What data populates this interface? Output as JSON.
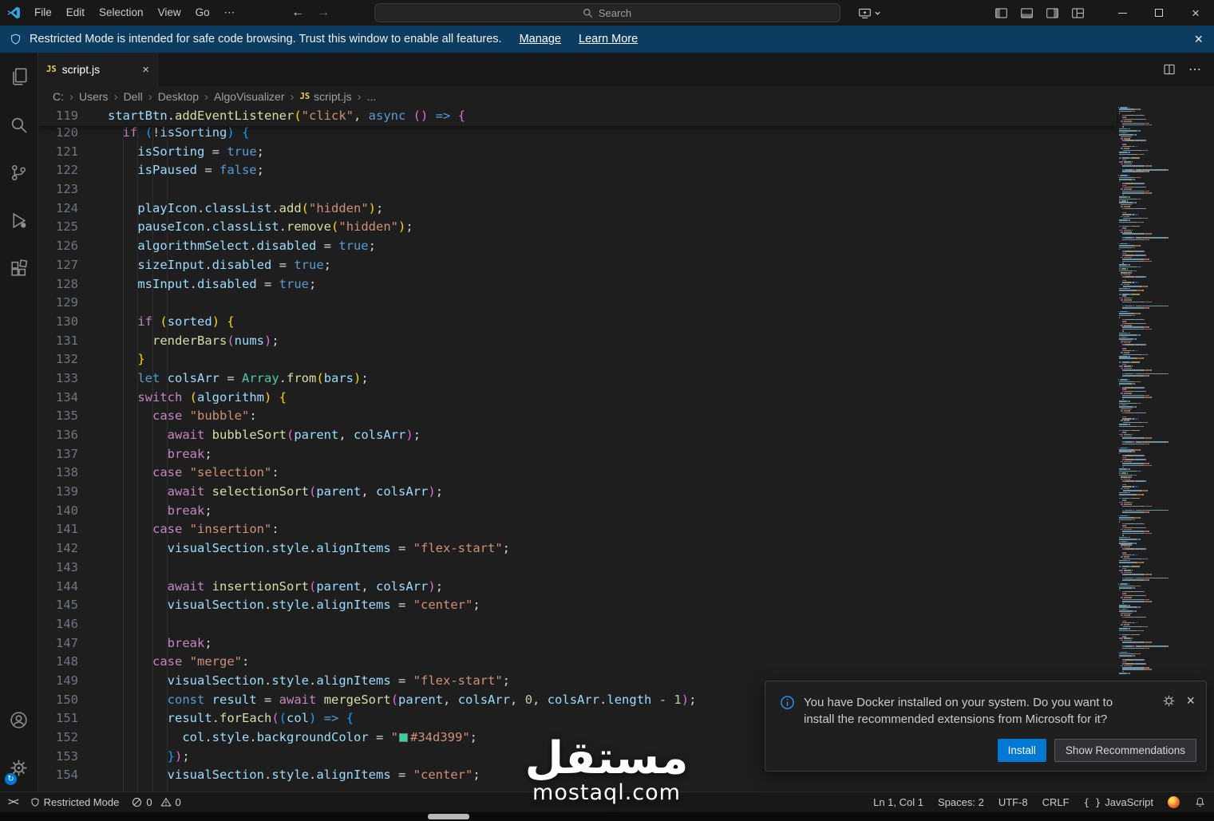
{
  "titlebar": {
    "menus": [
      "File",
      "Edit",
      "Selection",
      "View",
      "Go",
      "⋯"
    ],
    "search_placeholder": "Search"
  },
  "banner": {
    "text": "Restricted Mode is intended for safe code browsing. Trust this window to enable all features.",
    "manage": "Manage",
    "learn_more": "Learn More"
  },
  "tabs": {
    "active_label": "script.js"
  },
  "breadcrumbs": {
    "items": [
      "C:",
      "Users",
      "Dell",
      "Desktop",
      "AlgoVisualizer",
      "script.js",
      "..."
    ]
  },
  "editor": {
    "token_colors": {
      "d": "#d4d4d4",
      "v": "#9cdcfe",
      "f": "#dcdcaa",
      "s": "#ce9178",
      "k": "#c586c0",
      "b": "#569cd6",
      "n": "#b5cea8",
      "c": "#4ec9b0",
      "p1": "#ffd700",
      "p2": "#da70d6",
      "p3": "#179fff"
    },
    "accent_color": "#0078d4",
    "swatch_color": "#34d399",
    "sticky_line": {
      "n": 119,
      "t": [
        [
          "v",
          "startBtn"
        ],
        [
          "d",
          "."
        ],
        [
          "f",
          "addEventListener"
        ],
        [
          "p1",
          "("
        ],
        [
          "s",
          "\"click\""
        ],
        [
          "d",
          ", "
        ],
        [
          "b",
          "async"
        ],
        [
          "d",
          " "
        ],
        [
          "p2",
          "()"
        ],
        [
          "d",
          " "
        ],
        [
          "b",
          "=>"
        ],
        [
          "d",
          " "
        ],
        [
          "p2",
          "{"
        ]
      ]
    },
    "lines": [
      {
        "n": 120,
        "t": [
          [
            "d",
            "  "
          ],
          [
            "k",
            "if"
          ],
          [
            "d",
            " "
          ],
          [
            "p3",
            "("
          ],
          [
            "d",
            "!"
          ],
          [
            "v",
            "isSorting"
          ],
          [
            "p3",
            ")"
          ],
          [
            "d",
            " "
          ],
          [
            "p3",
            "{"
          ]
        ]
      },
      {
        "n": 121,
        "t": [
          [
            "d",
            "    "
          ],
          [
            "v",
            "isSorting"
          ],
          [
            "d",
            " = "
          ],
          [
            "b",
            "true"
          ],
          [
            "d",
            ";"
          ]
        ]
      },
      {
        "n": 122,
        "t": [
          [
            "d",
            "    "
          ],
          [
            "v",
            "isPaused"
          ],
          [
            "d",
            " = "
          ],
          [
            "b",
            "false"
          ],
          [
            "d",
            ";"
          ]
        ]
      },
      {
        "n": 123,
        "t": []
      },
      {
        "n": 124,
        "t": [
          [
            "d",
            "    "
          ],
          [
            "v",
            "playIcon"
          ],
          [
            "d",
            "."
          ],
          [
            "v",
            "classList"
          ],
          [
            "d",
            "."
          ],
          [
            "f",
            "add"
          ],
          [
            "p1",
            "("
          ],
          [
            "s",
            "\"hidden\""
          ],
          [
            "p1",
            ")"
          ],
          [
            "d",
            ";"
          ]
        ]
      },
      {
        "n": 125,
        "t": [
          [
            "d",
            "    "
          ],
          [
            "v",
            "pauseIcon"
          ],
          [
            "d",
            "."
          ],
          [
            "v",
            "classList"
          ],
          [
            "d",
            "."
          ],
          [
            "f",
            "remove"
          ],
          [
            "p1",
            "("
          ],
          [
            "s",
            "\"hidden\""
          ],
          [
            "p1",
            ")"
          ],
          [
            "d",
            ";"
          ]
        ]
      },
      {
        "n": 126,
        "t": [
          [
            "d",
            "    "
          ],
          [
            "v",
            "algorithmSelect"
          ],
          [
            "d",
            "."
          ],
          [
            "v",
            "disabled"
          ],
          [
            "d",
            " = "
          ],
          [
            "b",
            "true"
          ],
          [
            "d",
            ";"
          ]
        ]
      },
      {
        "n": 127,
        "t": [
          [
            "d",
            "    "
          ],
          [
            "v",
            "sizeInput"
          ],
          [
            "d",
            "."
          ],
          [
            "v",
            "disabled"
          ],
          [
            "d",
            " = "
          ],
          [
            "b",
            "true"
          ],
          [
            "d",
            ";"
          ]
        ]
      },
      {
        "n": 128,
        "t": [
          [
            "d",
            "    "
          ],
          [
            "v",
            "msInput"
          ],
          [
            "d",
            "."
          ],
          [
            "v",
            "disabled"
          ],
          [
            "d",
            " = "
          ],
          [
            "b",
            "true"
          ],
          [
            "d",
            ";"
          ]
        ]
      },
      {
        "n": 129,
        "t": []
      },
      {
        "n": 130,
        "t": [
          [
            "d",
            "    "
          ],
          [
            "k",
            "if"
          ],
          [
            "d",
            " "
          ],
          [
            "p1",
            "("
          ],
          [
            "v",
            "sorted"
          ],
          [
            "p1",
            ")"
          ],
          [
            "d",
            " "
          ],
          [
            "p1",
            "{"
          ]
        ]
      },
      {
        "n": 131,
        "t": [
          [
            "d",
            "      "
          ],
          [
            "f",
            "renderBars"
          ],
          [
            "p2",
            "("
          ],
          [
            "v",
            "nums"
          ],
          [
            "p2",
            ")"
          ],
          [
            "d",
            ";"
          ]
        ]
      },
      {
        "n": 132,
        "t": [
          [
            "d",
            "    "
          ],
          [
            "p1",
            "}"
          ]
        ]
      },
      {
        "n": 133,
        "t": [
          [
            "d",
            "    "
          ],
          [
            "b",
            "let"
          ],
          [
            "d",
            " "
          ],
          [
            "v",
            "colsArr"
          ],
          [
            "d",
            " = "
          ],
          [
            "c",
            "Array"
          ],
          [
            "d",
            "."
          ],
          [
            "f",
            "from"
          ],
          [
            "p1",
            "("
          ],
          [
            "v",
            "bars"
          ],
          [
            "p1",
            ")"
          ],
          [
            "d",
            ";"
          ]
        ]
      },
      {
        "n": 134,
        "t": [
          [
            "d",
            "    "
          ],
          [
            "k",
            "switch"
          ],
          [
            "d",
            " "
          ],
          [
            "p1",
            "("
          ],
          [
            "v",
            "algorithm"
          ],
          [
            "p1",
            ")"
          ],
          [
            "d",
            " "
          ],
          [
            "p1",
            "{"
          ]
        ]
      },
      {
        "n": 135,
        "t": [
          [
            "d",
            "      "
          ],
          [
            "k",
            "case"
          ],
          [
            "d",
            " "
          ],
          [
            "s",
            "\"bubble\""
          ],
          [
            "d",
            ":"
          ]
        ]
      },
      {
        "n": 136,
        "t": [
          [
            "d",
            "        "
          ],
          [
            "k",
            "await"
          ],
          [
            "d",
            " "
          ],
          [
            "f",
            "bubbleSort"
          ],
          [
            "p2",
            "("
          ],
          [
            "v",
            "parent"
          ],
          [
            "d",
            ", "
          ],
          [
            "v",
            "colsArr"
          ],
          [
            "p2",
            ")"
          ],
          [
            "d",
            ";"
          ]
        ]
      },
      {
        "n": 137,
        "t": [
          [
            "d",
            "        "
          ],
          [
            "k",
            "break"
          ],
          [
            "d",
            ";"
          ]
        ]
      },
      {
        "n": 138,
        "t": [
          [
            "d",
            "      "
          ],
          [
            "k",
            "case"
          ],
          [
            "d",
            " "
          ],
          [
            "s",
            "\"selection\""
          ],
          [
            "d",
            ":"
          ]
        ]
      },
      {
        "n": 139,
        "t": [
          [
            "d",
            "        "
          ],
          [
            "k",
            "await"
          ],
          [
            "d",
            " "
          ],
          [
            "f",
            "selectionSort"
          ],
          [
            "p2",
            "("
          ],
          [
            "v",
            "parent"
          ],
          [
            "d",
            ", "
          ],
          [
            "v",
            "colsArr"
          ],
          [
            "p2",
            ")"
          ],
          [
            "d",
            ";"
          ]
        ]
      },
      {
        "n": 140,
        "t": [
          [
            "d",
            "        "
          ],
          [
            "k",
            "break"
          ],
          [
            "d",
            ";"
          ]
        ]
      },
      {
        "n": 141,
        "t": [
          [
            "d",
            "      "
          ],
          [
            "k",
            "case"
          ],
          [
            "d",
            " "
          ],
          [
            "s",
            "\"insertion\""
          ],
          [
            "d",
            ":"
          ]
        ]
      },
      {
        "n": 142,
        "t": [
          [
            "d",
            "        "
          ],
          [
            "v",
            "visualSection"
          ],
          [
            "d",
            "."
          ],
          [
            "v",
            "style"
          ],
          [
            "d",
            "."
          ],
          [
            "v",
            "alignItems"
          ],
          [
            "d",
            " = "
          ],
          [
            "s",
            "\"flex-start\""
          ],
          [
            "d",
            ";"
          ]
        ]
      },
      {
        "n": 143,
        "t": []
      },
      {
        "n": 144,
        "t": [
          [
            "d",
            "        "
          ],
          [
            "k",
            "await"
          ],
          [
            "d",
            " "
          ],
          [
            "f",
            "insertionSort"
          ],
          [
            "p2",
            "("
          ],
          [
            "v",
            "parent"
          ],
          [
            "d",
            ", "
          ],
          [
            "v",
            "colsArr"
          ],
          [
            "p2",
            ")"
          ],
          [
            "d",
            ";"
          ]
        ]
      },
      {
        "n": 145,
        "t": [
          [
            "d",
            "        "
          ],
          [
            "v",
            "visualSection"
          ],
          [
            "d",
            "."
          ],
          [
            "v",
            "style"
          ],
          [
            "d",
            "."
          ],
          [
            "v",
            "alignItems"
          ],
          [
            "d",
            " = "
          ],
          [
            "s",
            "\"center\""
          ],
          [
            "d",
            ";"
          ]
        ]
      },
      {
        "n": 146,
        "t": []
      },
      {
        "n": 147,
        "t": [
          [
            "d",
            "        "
          ],
          [
            "k",
            "break"
          ],
          [
            "d",
            ";"
          ]
        ]
      },
      {
        "n": 148,
        "t": [
          [
            "d",
            "      "
          ],
          [
            "k",
            "case"
          ],
          [
            "d",
            " "
          ],
          [
            "s",
            "\"merge\""
          ],
          [
            "d",
            ":"
          ]
        ]
      },
      {
        "n": 149,
        "t": [
          [
            "d",
            "        "
          ],
          [
            "v",
            "visualSection"
          ],
          [
            "d",
            "."
          ],
          [
            "v",
            "style"
          ],
          [
            "d",
            "."
          ],
          [
            "v",
            "alignItems"
          ],
          [
            "d",
            " = "
          ],
          [
            "s",
            "\"flex-start\""
          ],
          [
            "d",
            ";"
          ]
        ]
      },
      {
        "n": 150,
        "t": [
          [
            "d",
            "        "
          ],
          [
            "b",
            "const"
          ],
          [
            "d",
            " "
          ],
          [
            "v",
            "result"
          ],
          [
            "d",
            " = "
          ],
          [
            "k",
            "await"
          ],
          [
            "d",
            " "
          ],
          [
            "f",
            "mergeSort"
          ],
          [
            "p2",
            "("
          ],
          [
            "v",
            "parent"
          ],
          [
            "d",
            ", "
          ],
          [
            "v",
            "colsArr"
          ],
          [
            "d",
            ", "
          ],
          [
            "n",
            "0"
          ],
          [
            "d",
            ", "
          ],
          [
            "v",
            "colsArr"
          ],
          [
            "d",
            "."
          ],
          [
            "v",
            "length"
          ],
          [
            "d",
            " - "
          ],
          [
            "n",
            "1"
          ],
          [
            "p2",
            ")"
          ],
          [
            "d",
            ";"
          ]
        ]
      },
      {
        "n": 151,
        "t": [
          [
            "d",
            "        "
          ],
          [
            "v",
            "result"
          ],
          [
            "d",
            "."
          ],
          [
            "f",
            "forEach"
          ],
          [
            "p2",
            "("
          ],
          [
            "p3",
            "("
          ],
          [
            "v",
            "col"
          ],
          [
            "p3",
            ")"
          ],
          [
            "d",
            " "
          ],
          [
            "b",
            "=>"
          ],
          [
            "d",
            " "
          ],
          [
            "p3",
            "{"
          ]
        ]
      },
      {
        "n": 152,
        "t": [
          [
            "d",
            "          "
          ],
          [
            "v",
            "col"
          ],
          [
            "d",
            "."
          ],
          [
            "v",
            "style"
          ],
          [
            "d",
            "."
          ],
          [
            "v",
            "backgroundColor"
          ],
          [
            "d",
            " = "
          ],
          [
            "s",
            "\""
          ],
          [
            "sw",
            "#34d399"
          ],
          [
            "s",
            "#34d399\""
          ],
          [
            "d",
            ";"
          ]
        ]
      },
      {
        "n": 153,
        "t": [
          [
            "d",
            "        "
          ],
          [
            "p3",
            "}"
          ],
          [
            "p2",
            ")"
          ],
          [
            "d",
            ";"
          ]
        ]
      },
      {
        "n": 154,
        "t": [
          [
            "d",
            "        "
          ],
          [
            "v",
            "visualSection"
          ],
          [
            "d",
            "."
          ],
          [
            "v",
            "style"
          ],
          [
            "d",
            "."
          ],
          [
            "v",
            "alignItems"
          ],
          [
            "d",
            " = "
          ],
          [
            "s",
            "\"center\""
          ],
          [
            "d",
            ";"
          ]
        ]
      }
    ]
  },
  "notification": {
    "message": "You have Docker installed on your system. Do you want to install the recommended extensions from Microsoft for it?",
    "install_label": "Install",
    "show_recommendations_label": "Show Recommendations"
  },
  "statusbar": {
    "restricted_label": "Restricted Mode",
    "errors": "0",
    "warnings": "0",
    "ln_col": "Ln 1, Col 1",
    "spaces": "Spaces: 2",
    "encoding": "UTF-8",
    "eol": "CRLF",
    "language": "JavaScript",
    "braces": "{ }"
  },
  "watermark": {
    "title": "مستقل",
    "subtitle": "mostaql.com"
  }
}
